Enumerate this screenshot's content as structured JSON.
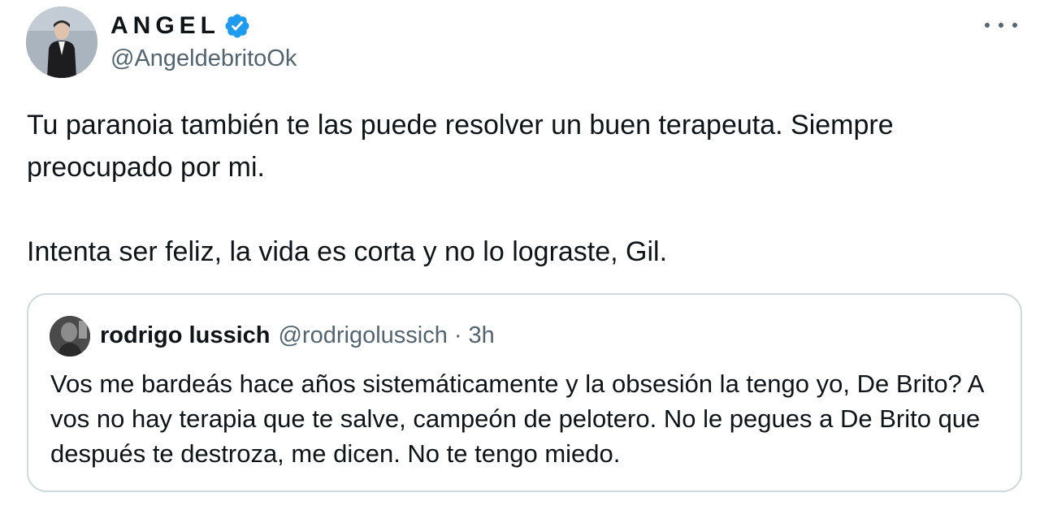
{
  "author": {
    "display_name": "ANGEL",
    "handle": "@AngeldebritoOk",
    "verified": true
  },
  "tweet": {
    "paragraphs": [
      "Tu paranoia también te las puede resolver un buen terapeuta. Siempre preocupado por mi.",
      "Intenta ser feliz, la vida es corta y no lo lograste, Gil."
    ]
  },
  "quoted": {
    "display_name": "rodrigo lussich",
    "handle": "@rodrigolussich",
    "separator": "·",
    "time": "3h",
    "text": "Vos me bardeás hace años sistemáticamente y la obsesión la tengo yo, De Brito? A vos no hay terapia que te salve, campeón de pelotero. No le pegues a De Brito que después te destroza, me dicen. No te tengo miedo."
  },
  "icons": {
    "verified": "verified-badge-icon",
    "more": "more-options-icon"
  },
  "colors": {
    "text_primary": "#0f1419",
    "text_secondary": "#536471",
    "verified_blue": "#1d9bf0",
    "border": "#cfd9de"
  }
}
